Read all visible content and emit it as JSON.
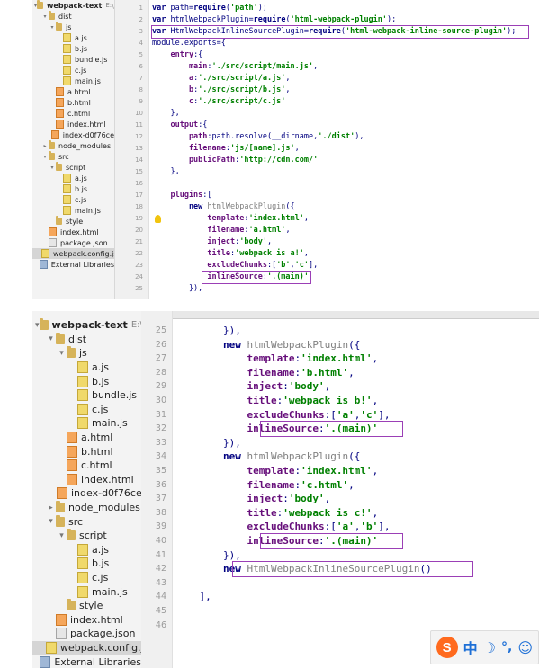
{
  "top": {
    "tree": [
      {
        "label": "webpack-text",
        "suffix": "E:\\JS",
        "type": "folder",
        "depth": 0,
        "open": true,
        "bold": true
      },
      {
        "label": "dist",
        "type": "folder",
        "depth": 1,
        "open": true
      },
      {
        "label": "js",
        "type": "folder",
        "depth": 2,
        "open": true
      },
      {
        "label": "a.js",
        "type": "js",
        "depth": 3
      },
      {
        "label": "b.js",
        "type": "js",
        "depth": 3
      },
      {
        "label": "bundle.js",
        "type": "js",
        "depth": 3
      },
      {
        "label": "c.js",
        "type": "js",
        "depth": 3
      },
      {
        "label": "main.js",
        "type": "js",
        "depth": 3
      },
      {
        "label": "a.html",
        "type": "html",
        "depth": 2
      },
      {
        "label": "b.html",
        "type": "html",
        "depth": 2
      },
      {
        "label": "c.html",
        "type": "html",
        "depth": 2
      },
      {
        "label": "index.html",
        "type": "html",
        "depth": 2
      },
      {
        "label": "index-d0f76ce",
        "type": "html",
        "depth": 2
      },
      {
        "label": "node_modules",
        "type": "folder",
        "depth": 1,
        "open": false
      },
      {
        "label": "src",
        "type": "folder",
        "depth": 1,
        "open": true
      },
      {
        "label": "script",
        "type": "folder",
        "depth": 2,
        "open": true
      },
      {
        "label": "a.js",
        "type": "js",
        "depth": 3
      },
      {
        "label": "b.js",
        "type": "js",
        "depth": 3
      },
      {
        "label": "c.js",
        "type": "js",
        "depth": 3
      },
      {
        "label": "main.js",
        "type": "js",
        "depth": 3
      },
      {
        "label": "style",
        "type": "folder",
        "depth": 2
      },
      {
        "label": "index.html",
        "type": "html",
        "depth": 1
      },
      {
        "label": "package.json",
        "type": "json",
        "depth": 1
      },
      {
        "label": "webpack.config.js",
        "type": "js",
        "depth": 1,
        "selected": true
      },
      {
        "label": "External Libraries",
        "type": "lib",
        "depth": 0
      }
    ],
    "lines": [
      {
        "n": "1",
        "t": [
          [
            "k",
            "var "
          ],
          [
            "",
            "path="
          ],
          [
            "k",
            "require"
          ],
          [
            "",
            "("
          ],
          [
            "s",
            "'path'"
          ],
          [
            "",
            ");"
          ]
        ]
      },
      {
        "n": "2",
        "t": [
          [
            "k",
            "var "
          ],
          [
            "",
            "htmlWebpackPlugin="
          ],
          [
            "k",
            "require"
          ],
          [
            "",
            "("
          ],
          [
            "s",
            "'html-webpack-plugin'"
          ],
          [
            "",
            ");"
          ]
        ]
      },
      {
        "n": "3",
        "t": [
          [
            "k",
            "var "
          ],
          [
            "",
            "HtmlWebpackInlineSourcePlugin="
          ],
          [
            "k",
            "require"
          ],
          [
            "",
            "("
          ],
          [
            "s",
            "'html-webpack-inline-source-plugin'"
          ],
          [
            "",
            ");"
          ]
        ]
      },
      {
        "n": "4",
        "t": [
          [
            "",
            "module.exports={"
          ]
        ]
      },
      {
        "n": "5",
        "t": [
          [
            "p",
            "    entry"
          ],
          [
            "",
            ":{"
          ]
        ]
      },
      {
        "n": "6",
        "t": [
          [
            "p",
            "        main"
          ],
          [
            "",
            ":"
          ],
          [
            "s",
            "'./src/script/main.js'"
          ],
          [
            "",
            ","
          ]
        ]
      },
      {
        "n": "7",
        "t": [
          [
            "p",
            "        a"
          ],
          [
            "",
            ":"
          ],
          [
            "s",
            "'./src/script/a.js'"
          ],
          [
            "",
            ","
          ]
        ]
      },
      {
        "n": "8",
        "t": [
          [
            "p",
            "        b"
          ],
          [
            "",
            ":"
          ],
          [
            "s",
            "'./src/script/b.js'"
          ],
          [
            "",
            ","
          ]
        ]
      },
      {
        "n": "9",
        "t": [
          [
            "p",
            "        c"
          ],
          [
            "",
            ":"
          ],
          [
            "s",
            "'./src/script/c.js'"
          ]
        ]
      },
      {
        "n": "10",
        "t": [
          [
            "",
            "    },"
          ]
        ]
      },
      {
        "n": "11",
        "t": [
          [
            "p",
            "    output"
          ],
          [
            "",
            ":{"
          ]
        ]
      },
      {
        "n": "12",
        "t": [
          [
            "p",
            "        path"
          ],
          [
            "",
            ":path.resolve(__dirname,"
          ],
          [
            "s",
            "'./dist'"
          ],
          [
            "",
            "),"
          ]
        ]
      },
      {
        "n": "13",
        "t": [
          [
            "p",
            "        filename"
          ],
          [
            "",
            ":"
          ],
          [
            "s",
            "'js/[name].js'"
          ],
          [
            "",
            ","
          ]
        ]
      },
      {
        "n": "14",
        "t": [
          [
            "p",
            "        publicPath"
          ],
          [
            "",
            ":"
          ],
          [
            "s",
            "'http://cdn.com/'"
          ]
        ]
      },
      {
        "n": "15",
        "t": [
          [
            "",
            "    },"
          ]
        ]
      },
      {
        "n": "16",
        "t": [
          [
            "",
            ""
          ]
        ]
      },
      {
        "n": "17",
        "t": [
          [
            "p",
            "    plugins"
          ],
          [
            "",
            ":["
          ]
        ]
      },
      {
        "n": "18",
        "t": [
          [
            "k",
            "        new "
          ],
          [
            "f",
            "htmlWebpackPlugin"
          ],
          [
            "",
            "({"
          ]
        ]
      },
      {
        "n": "19",
        "t": [
          [
            "p",
            "            template"
          ],
          [
            "",
            ":"
          ],
          [
            "s",
            "'index.html'"
          ],
          [
            "",
            ","
          ]
        ]
      },
      {
        "n": "20",
        "t": [
          [
            "p",
            "            filename"
          ],
          [
            "",
            ":"
          ],
          [
            "s",
            "'a.html'"
          ],
          [
            "",
            ","
          ]
        ]
      },
      {
        "n": "21",
        "t": [
          [
            "p",
            "            inject"
          ],
          [
            "",
            ":"
          ],
          [
            "s",
            "'body'"
          ],
          [
            "",
            ","
          ]
        ]
      },
      {
        "n": "22",
        "t": [
          [
            "p",
            "            title"
          ],
          [
            "",
            ":"
          ],
          [
            "s",
            "'webpack is a!'"
          ],
          [
            "",
            ","
          ]
        ]
      },
      {
        "n": "23",
        "t": [
          [
            "p",
            "            excludeChunks"
          ],
          [
            "",
            ":["
          ],
          [
            "s",
            "'b'"
          ],
          [
            "",
            ","
          ],
          [
            "s",
            "'c'"
          ],
          [
            "",
            "],"
          ]
        ]
      },
      {
        "n": "24",
        "t": [
          [
            "p",
            "            inlineSource"
          ],
          [
            "",
            ":"
          ],
          [
            "s",
            "'.(main)'"
          ]
        ]
      },
      {
        "n": "25",
        "t": [
          [
            "",
            "        }),"
          ]
        ]
      }
    ]
  },
  "bottom": {
    "tree": [
      {
        "label": "webpack-text",
        "suffix": "E:\\JS",
        "type": "folder",
        "depth": 0,
        "open": true,
        "bold": true
      },
      {
        "label": "dist",
        "type": "folder",
        "depth": 1,
        "open": true
      },
      {
        "label": "js",
        "type": "folder",
        "depth": 2,
        "open": true
      },
      {
        "label": "a.js",
        "type": "js",
        "depth": 3
      },
      {
        "label": "b.js",
        "type": "js",
        "depth": 3
      },
      {
        "label": "bundle.js",
        "type": "js",
        "depth": 3
      },
      {
        "label": "c.js",
        "type": "js",
        "depth": 3
      },
      {
        "label": "main.js",
        "type": "js",
        "depth": 3
      },
      {
        "label": "a.html",
        "type": "html",
        "depth": 2
      },
      {
        "label": "b.html",
        "type": "html",
        "depth": 2
      },
      {
        "label": "c.html",
        "type": "html",
        "depth": 2
      },
      {
        "label": "index.html",
        "type": "html",
        "depth": 2
      },
      {
        "label": "index-d0f76ce",
        "type": "html",
        "depth": 2
      },
      {
        "label": "node_modules",
        "type": "folder",
        "depth": 1,
        "open": false
      },
      {
        "label": "src",
        "type": "folder",
        "depth": 1,
        "open": true
      },
      {
        "label": "script",
        "type": "folder",
        "depth": 2,
        "open": true
      },
      {
        "label": "a.js",
        "type": "js",
        "depth": 3
      },
      {
        "label": "b.js",
        "type": "js",
        "depth": 3
      },
      {
        "label": "c.js",
        "type": "js",
        "depth": 3
      },
      {
        "label": "main.js",
        "type": "js",
        "depth": 3
      },
      {
        "label": "style",
        "type": "folder",
        "depth": 2
      },
      {
        "label": "index.html",
        "type": "html",
        "depth": 1
      },
      {
        "label": "package.json",
        "type": "json",
        "depth": 1
      },
      {
        "label": "webpack.config.js",
        "type": "js",
        "depth": 1,
        "selected": true
      },
      {
        "label": "External Libraries",
        "type": "lib",
        "depth": 0
      }
    ],
    "lines": [
      {
        "n": "25",
        "t": [
          [
            "",
            "        }),"
          ]
        ]
      },
      {
        "n": "26",
        "t": [
          [
            "k",
            "        new "
          ],
          [
            "f",
            "htmlWebpackPlugin"
          ],
          [
            "",
            "({"
          ]
        ]
      },
      {
        "n": "27",
        "t": [
          [
            "p",
            "            template"
          ],
          [
            "",
            ":"
          ],
          [
            "s",
            "'index.html'"
          ],
          [
            "",
            ","
          ]
        ]
      },
      {
        "n": "28",
        "t": [
          [
            "p",
            "            filename"
          ],
          [
            "",
            ":"
          ],
          [
            "s",
            "'b.html'"
          ],
          [
            "",
            ","
          ]
        ]
      },
      {
        "n": "29",
        "t": [
          [
            "p",
            "            inject"
          ],
          [
            "",
            ":"
          ],
          [
            "s",
            "'body'"
          ],
          [
            "",
            ","
          ]
        ]
      },
      {
        "n": "30",
        "t": [
          [
            "p",
            "            title"
          ],
          [
            "",
            ":"
          ],
          [
            "s",
            "'webpack is b!'"
          ],
          [
            "",
            ","
          ]
        ]
      },
      {
        "n": "31",
        "t": [
          [
            "p",
            "            excludeChunks"
          ],
          [
            "",
            ":["
          ],
          [
            "s",
            "'a'"
          ],
          [
            "",
            ","
          ],
          [
            "s",
            "'c'"
          ],
          [
            "",
            "],"
          ]
        ]
      },
      {
        "n": "32",
        "t": [
          [
            "p",
            "            inlineSource"
          ],
          [
            "",
            ":"
          ],
          [
            "s",
            "'.(main)'"
          ]
        ]
      },
      {
        "n": "33",
        "t": [
          [
            "",
            "        }),"
          ]
        ]
      },
      {
        "n": "34",
        "t": [
          [
            "k",
            "        new "
          ],
          [
            "f",
            "htmlWebpackPlugin"
          ],
          [
            "",
            "({"
          ]
        ]
      },
      {
        "n": "35",
        "t": [
          [
            "p",
            "            template"
          ],
          [
            "",
            ":"
          ],
          [
            "s",
            "'index.html'"
          ],
          [
            "",
            ","
          ]
        ]
      },
      {
        "n": "36",
        "t": [
          [
            "p",
            "            filename"
          ],
          [
            "",
            ":"
          ],
          [
            "s",
            "'c.html'"
          ],
          [
            "",
            ","
          ]
        ]
      },
      {
        "n": "37",
        "t": [
          [
            "p",
            "            inject"
          ],
          [
            "",
            ":"
          ],
          [
            "s",
            "'body'"
          ],
          [
            "",
            ","
          ]
        ]
      },
      {
        "n": "38",
        "t": [
          [
            "p",
            "            title"
          ],
          [
            "",
            ":"
          ],
          [
            "s",
            "'webpack is c!'"
          ],
          [
            "",
            ","
          ]
        ]
      },
      {
        "n": "39",
        "t": [
          [
            "p",
            "            excludeChunks"
          ],
          [
            "",
            ":["
          ],
          [
            "s",
            "'a'"
          ],
          [
            "",
            ","
          ],
          [
            "s",
            "'b'"
          ],
          [
            "",
            "],"
          ]
        ]
      },
      {
        "n": "40",
        "t": [
          [
            "p",
            "            inlineSource"
          ],
          [
            "",
            ":"
          ],
          [
            "s",
            "'.(main)'"
          ]
        ]
      },
      {
        "n": "41",
        "t": [
          [
            "",
            "        }),"
          ]
        ]
      },
      {
        "n": "42",
        "t": [
          [
            "k",
            "        new "
          ],
          [
            "f",
            "HtmlWebpackInlineSourcePlugin"
          ],
          [
            "",
            "()"
          ]
        ]
      },
      {
        "n": "43",
        "t": [
          [
            "",
            ""
          ]
        ]
      },
      {
        "n": "44",
        "t": [
          [
            "",
            "    ],"
          ]
        ]
      },
      {
        "n": "45",
        "t": [
          [
            "",
            ""
          ]
        ]
      },
      {
        "n": "46",
        "t": [
          [
            "",
            ""
          ]
        ]
      }
    ]
  },
  "ime": {
    "brand": "S",
    "lang": "中",
    "moon": "☽",
    "punct": "°,",
    "emoji": "☺"
  }
}
